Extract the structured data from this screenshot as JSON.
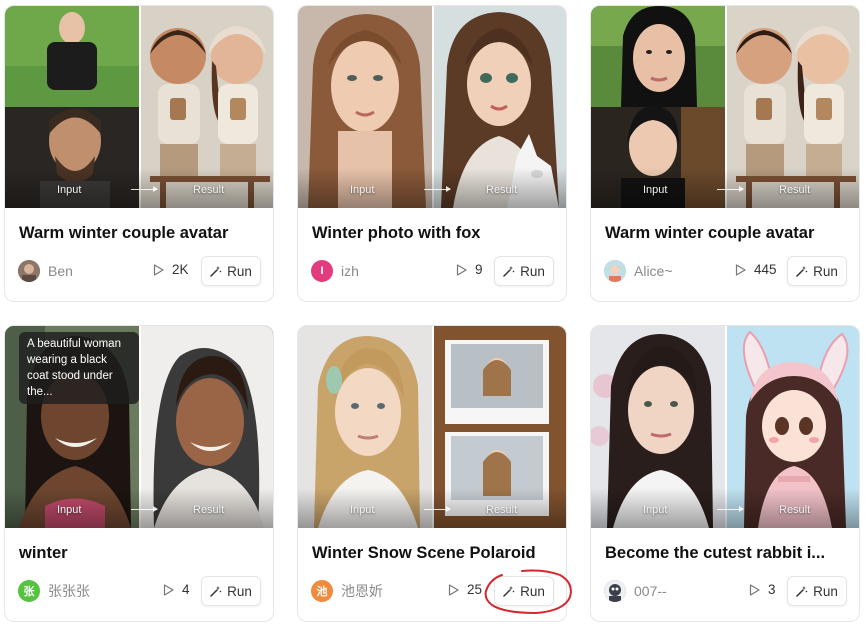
{
  "labels": {
    "input": "Input",
    "result": "Result",
    "run": "Run"
  },
  "colors": {
    "annotation": "#d8262e",
    "border": "#e6e6e6",
    "muted_text": "#8a8a8a"
  },
  "cards": [
    {
      "title": "Warm winter couple avatar",
      "author": "Ben",
      "avatar_letter": "",
      "avatar_color": "#9a7a66",
      "plays": "2K",
      "prompt": ""
    },
    {
      "title": "Winter photo with fox",
      "author": "izh",
      "avatar_letter": "I",
      "avatar_color": "#e23c7e",
      "plays": "9",
      "prompt": ""
    },
    {
      "title": "Warm winter couple avatar",
      "author": "Alice~",
      "avatar_letter": "",
      "avatar_color": "#c9a98e",
      "plays": "445",
      "prompt": ""
    },
    {
      "title": "winter",
      "author": "张张张",
      "avatar_letter": "张",
      "avatar_color": "#55c240",
      "plays": "4",
      "prompt": "A beautiful woman wearing a black coat stood under the..."
    },
    {
      "title": "Winter Snow Scene Polaroid",
      "author": "池恩妡",
      "avatar_letter": "池",
      "avatar_color": "#f08a3c",
      "plays": "25",
      "prompt": ""
    },
    {
      "title": "Become the cutest rabbit i...",
      "author": "007--",
      "avatar_letter": "",
      "avatar_color": "#5a6270",
      "plays": "3",
      "prompt": ""
    }
  ]
}
